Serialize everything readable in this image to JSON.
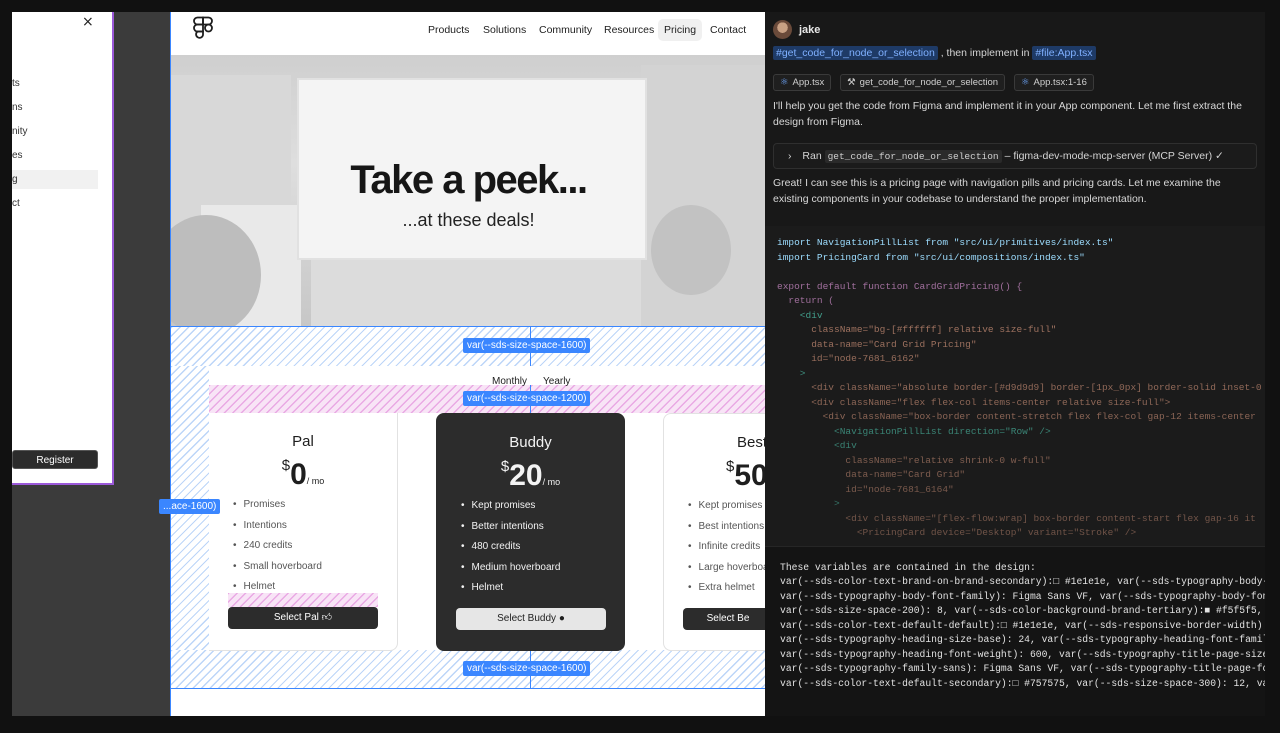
{
  "canvas": {
    "mobile_menu": {
      "close_icon": "×",
      "items": [
        "Products",
        "Solutions",
        "Community",
        "Resources",
        "Pricing",
        "Contact"
      ],
      "visible_fragments": [
        "ts",
        "ns",
        "nity",
        "es",
        "g",
        "ct"
      ],
      "register_label": "Register"
    },
    "site": {
      "nav": [
        "Products",
        "Solutions",
        "Community",
        "Resources",
        "Pricing",
        "Contact"
      ],
      "active_nav": "Pricing",
      "hero_title": "Take a peek...",
      "hero_subtitle": "...at these deals!",
      "toggle": [
        "Monthly",
        "Yearly"
      ],
      "labels": {
        "space_1600_top": "var(--sds-size-space-1600)",
        "space_1200": "var(--sds-size-space-1200)",
        "space_1600_bottom": "var(--sds-size-space-1600)",
        "space_1600_left": "...ace-1600)"
      },
      "cards": [
        {
          "title": "Pal",
          "currency": "$",
          "amount": "0",
          "period": "/ mo",
          "features": [
            "Promises",
            "Intentions",
            "240 credits",
            "Small hoverboard",
            "Helmet"
          ],
          "button": "Select Pal",
          "button_icon": "thumbs-up-icon"
        },
        {
          "title": "Buddy",
          "currency": "$",
          "amount": "20",
          "period": "/ mo",
          "features": [
            "Kept promises",
            "Better intentions",
            "480 credits",
            "Medium hoverboard",
            "Helmet"
          ],
          "button": "Select Buddy",
          "button_icon": "dog-icon"
        },
        {
          "title": "Best",
          "currency": "$",
          "amount": "50",
          "period": "",
          "features": [
            "Kept promises",
            "Best intentions",
            "Infinite credits",
            "Large hoverboa",
            "Extra helmet"
          ],
          "button": "Select Be",
          "button_icon": ""
        }
      ]
    }
  },
  "chat": {
    "user": "jake",
    "prompt_chip_1": "#get_code_for_node_or_selection",
    "prompt_mid": ", then implement in",
    "prompt_chip_2": "#file:App.tsx",
    "context_items": [
      "App.tsx",
      "get_code_for_node_or_selection",
      "App.tsx:1-16"
    ],
    "reply_1": "I'll help you get the code from Figma and implement it in your App component. Let me first extract the design from Figma.",
    "tool_prefix": "Ran",
    "tool_name": "get_code_for_node_or_selection",
    "tool_suffix": "– figma-dev-mode-mcp-server (MCP Server) ✓",
    "reply_2": "Great! I can see this is a pricing page with navigation pills and pricing cards. Let me examine the existing components in your codebase to understand the proper implementation.",
    "code_lines": [
      "import NavigationPillList from \"src/ui/primitives/index.ts\"",
      "import PricingCard from \"src/ui/compositions/index.ts\"",
      "",
      "export default function CardGridPricing() {",
      "  return (",
      "    <div",
      "      className=\"bg-[#ffffff] relative size-full\"",
      "      data-name=\"Card Grid Pricing\"",
      "      id=\"node-7681_6162\"",
      "    >",
      "      <div className=\"absolute border-[#d9d9d9] border-[1px_0px] border-solid inset-0",
      "      <div className=\"flex flex-col items-center relative size-full\">",
      "        <div className=\"box-border content-stretch flex flex-col gap-12 items-center",
      "          <NavigationPillList direction=\"Row\" />",
      "          <div",
      "            className=\"relative shrink-0 w-full\"",
      "            data-name=\"Card Grid\"",
      "            id=\"node-7681_6164\"",
      "          >",
      "            <div className=\"[flex-flow:wrap] box-border content-start flex gap-16 it",
      "              <PricingCard device=\"Desktop\" variant=\"Stroke\" />"
    ],
    "vars_lines": [
      "These variables are contained in the design:",
      "var(--sds-color-text-brand-on-brand-secondary):□ #1e1e1e, var(--sds-typography-body-",
      "var(--sds-typography-body-font-family): Figma Sans VF, var(--sds-typography-body-font",
      "var(--sds-size-space-200): 8, var(--sds-color-background-brand-tertiary):■ #f5f5f5,",
      "var(--sds-color-text-default-default):□ #1e1e1e, var(--sds-responsive-border-width)",
      "var(--sds-typography-heading-size-base): 24, var(--sds-typography-heading-font-family",
      "var(--sds-typography-heading-font-weight): 600, var(--sds-typography-title-page-size",
      "var(--sds-typography-family-sans): Figma Sans VF, var(--sds-typography-title-page-fo",
      "var(--sds-color-text-default-secondary):□ #757575, var(--sds-size-space-300): 12, va"
    ]
  },
  "colors": {
    "accent_blue": "#3a86ff",
    "frame_purple": "#9b59d9",
    "chip_bg": "#1e3a66",
    "dark_card": "#2c2c2c"
  }
}
